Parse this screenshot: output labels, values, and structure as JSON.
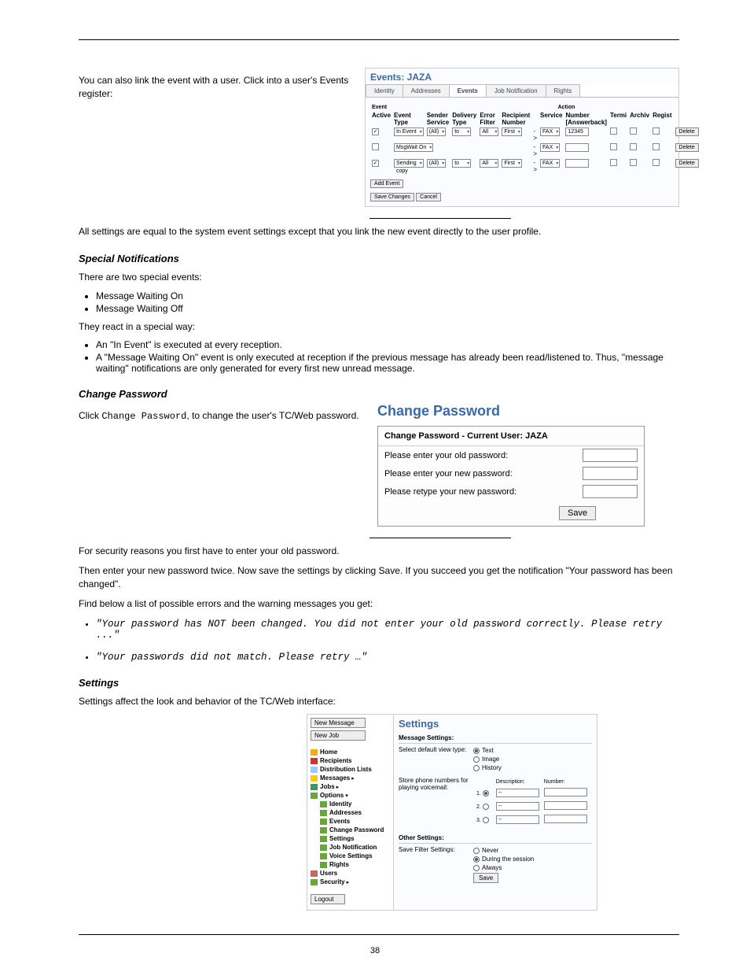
{
  "page": {
    "number": "38"
  },
  "intro_text": "You can also link the event with a user. Click into a user's Events register:",
  "events": {
    "title": "Events: JAZA",
    "tabs": [
      "Identity",
      "Addresses",
      "Events",
      "Job Notification",
      "Rights"
    ],
    "active_tab": "Events",
    "group_left": "Event",
    "group_right": "Action",
    "headers_left": [
      "Active",
      "Event Type",
      "Sender Service",
      "Delivery Type",
      "Error Filter",
      "Recipient Number"
    ],
    "headers_right": [
      "Service",
      "Number [Answerback]",
      "Termi",
      "Archiv",
      "Regist",
      ""
    ],
    "rows": [
      {
        "active": true,
        "event_type": "In Event",
        "sender_service": "(All)",
        "delivery_type": "to",
        "error_filter": "All",
        "recipient_number": "First",
        "service": "FAX",
        "number": "12345",
        "delete": "Delete"
      },
      {
        "active": false,
        "event_type": "MsgWait On",
        "sender_service": "",
        "delivery_type": "",
        "error_filter": "",
        "recipient_number": "",
        "service": "FAX",
        "number": "",
        "delete": "Delete"
      },
      {
        "active": true,
        "event_type": "Sending copy",
        "sender_service": "(All)",
        "delivery_type": "to",
        "error_filter": "All",
        "recipient_number": "First",
        "service": "FAX",
        "number": "",
        "delete": "Delete"
      }
    ],
    "add_event_btn": "Add Event",
    "save_btn": "Save Changes",
    "cancel_btn": "Cancel"
  },
  "after_events_text": "All settings are equal to the system event settings except that you link the new event directly to the user profile.",
  "special_notifications": {
    "heading": "Special Notifications",
    "intro": "There are two special events:",
    "items": [
      "Message Waiting On",
      "Message Waiting Off"
    ],
    "outro": "They react in a special way:",
    "items2": [
      "An \"In Event\" is executed at every reception.",
      "A \"Message Waiting On\" event is only executed at reception if the previous message has already been read/listened to. Thus, \"message waiting\" notifications are only generated for every first new unread message."
    ]
  },
  "change_password": {
    "heading": "Change Password",
    "para1_a": "Click",
    "para1_b": "Change Password",
    "para1_c": "to change the user's TC/Web password.",
    "title": "Change Password",
    "box_header": "Change Password - Current User: JAZA",
    "row1": "Please enter your old password:",
    "row2": "Please enter your new password:",
    "row3": "Please retype your new password:",
    "save": "Save",
    "para2": "For security reasons you first have to enter your old password.",
    "para3": "Then enter your new password twice. Now save the settings by clicking Save. If you succeed you get the notification \"Your password has been changed\".",
    "para4": "Find below a list of possible errors and the warning messages you get:",
    "errors": [
      "\"Your password has NOT been changed. You did not enter your old password correctly. Please retry ...\"",
      "\"Your passwords did not match. Please retry …\""
    ]
  },
  "settings": {
    "heading": "Settings",
    "intro": "Settings affect the look and behavior of the TC/Web interface:",
    "sidebar": {
      "new_message": "New Message",
      "new_job": "New Job",
      "items": [
        {
          "label": "Home",
          "bold": true
        },
        {
          "label": "Recipients",
          "bold": true
        },
        {
          "label": "Distribution Lists",
          "bold": true
        },
        {
          "label": "Messages",
          "bold": true,
          "expand": "right"
        },
        {
          "label": "Jobs",
          "bold": true,
          "expand": "right"
        },
        {
          "label": "Options",
          "bold": true,
          "expand": "down"
        },
        {
          "label": "Identity",
          "sub": true
        },
        {
          "label": "Addresses",
          "sub": true
        },
        {
          "label": "Events",
          "sub": true
        },
        {
          "label": "Change Password",
          "sub": true
        },
        {
          "label": "Settings",
          "sub": true
        },
        {
          "label": "Job Notification",
          "sub": true
        },
        {
          "label": "Voice Settings",
          "sub": true
        },
        {
          "label": "Rights",
          "sub": true
        },
        {
          "label": "Users",
          "bold": true
        },
        {
          "label": "Security",
          "bold": true,
          "expand": "right"
        }
      ],
      "logout": "Logout"
    },
    "main": {
      "title": "Settings",
      "section1": "Message Settings:",
      "row1_label": "Select default view type:",
      "row1_opts": [
        "Text",
        "Image",
        "History"
      ],
      "row2_label": "Store phone numbers for playing voicemail:",
      "num_headers": [
        "",
        "Description:",
        "Number:"
      ],
      "num_rows": [
        "1.",
        "2.",
        "3."
      ],
      "section2": "Other Settings:",
      "row3_label": "Save Filter Settings:",
      "row3_opts": [
        "Never",
        "During the session",
        "Always"
      ],
      "save": "Save"
    }
  }
}
